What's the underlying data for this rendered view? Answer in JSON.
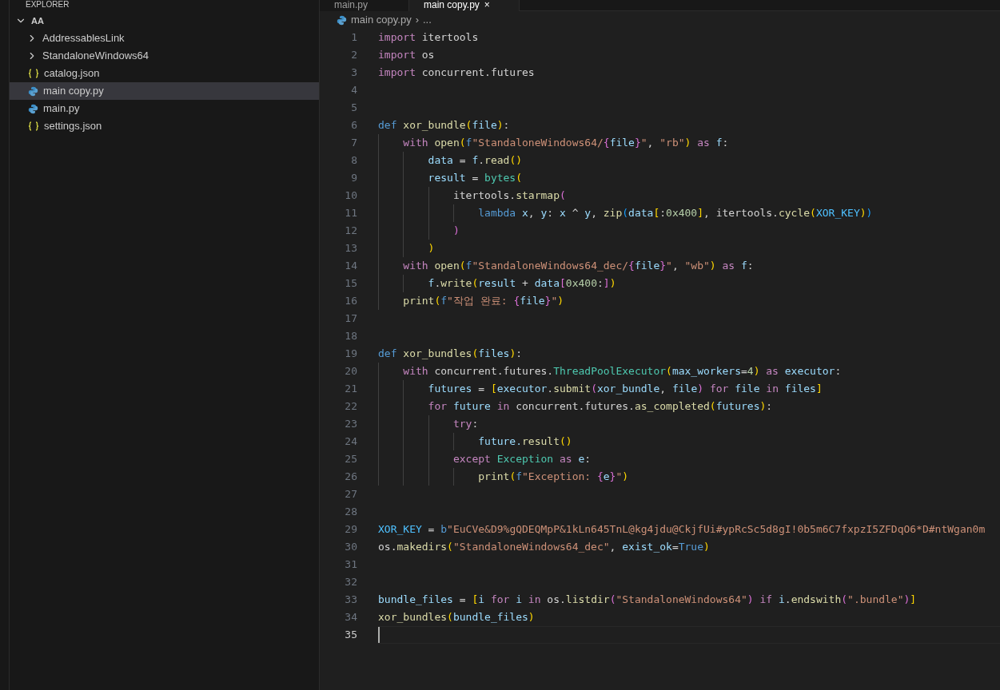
{
  "sidebar": {
    "title": "EXPLORER",
    "tree": [
      {
        "label": "AA",
        "kind": "folder",
        "expanded": true,
        "selected": false,
        "children": [
          {
            "label": "AddressablesLink",
            "kind": "folder",
            "expanded": false,
            "selected": false
          },
          {
            "label": "StandaloneWindows64",
            "kind": "folder",
            "expanded": false,
            "selected": false
          },
          {
            "label": "catalog.json",
            "kind": "json",
            "selected": false
          },
          {
            "label": "main copy.py",
            "kind": "python",
            "selected": true
          },
          {
            "label": "main.py",
            "kind": "python",
            "selected": false
          },
          {
            "label": "settings.json",
            "kind": "json",
            "selected": false
          }
        ]
      }
    ]
  },
  "tabs": [
    {
      "label": "main.py",
      "selected": false
    },
    {
      "label": "main copy.py",
      "selected": true,
      "close": "×"
    }
  ],
  "breadcrumb": {
    "file": "main copy.py",
    "separator": "›",
    "more": "..."
  },
  "code": [
    {
      "n": "1",
      "current": false,
      "tokens": [
        {
          "kind": "kw",
          "text": "import "
        },
        {
          "kind": "p",
          "text": "itertools"
        }
      ]
    },
    {
      "n": "2",
      "current": false,
      "tokens": [
        {
          "kind": "kw",
          "text": "import "
        },
        {
          "kind": "p",
          "text": "os"
        }
      ]
    },
    {
      "n": "3",
      "current": false,
      "tokens": [
        {
          "kind": "kw",
          "text": "import "
        },
        {
          "kind": "p",
          "text": "concurrent.futures"
        }
      ]
    },
    {
      "n": "4",
      "current": false
    },
    {
      "n": "5",
      "current": false
    },
    {
      "n": "6",
      "current": false,
      "tokens": [
        {
          "kind": "def",
          "text": "def "
        },
        {
          "kind": "fn",
          "text": "xor_bundle"
        },
        {
          "kind": "b1",
          "text": "("
        },
        {
          "kind": "var",
          "text": "file"
        },
        {
          "kind": "b1",
          "text": ")"
        },
        {
          "kind": "p",
          "text": ":"
        }
      ]
    },
    {
      "n": "7",
      "current": false,
      "tokens": [
        {
          "kind": "kw",
          "text": "    with "
        },
        {
          "kind": "fn",
          "text": "open"
        },
        {
          "kind": "b1",
          "text": "("
        },
        {
          "kind": "def",
          "text": "f"
        },
        {
          "kind": "str",
          "text": "\"StandaloneWindows64/"
        },
        {
          "kind": "esc",
          "text": "{"
        },
        {
          "kind": "var",
          "text": "file"
        },
        {
          "kind": "esc",
          "text": "}"
        },
        {
          "kind": "str",
          "text": "\""
        },
        {
          "kind": "p",
          "text": ", "
        },
        {
          "kind": "str",
          "text": "\"rb\""
        },
        {
          "kind": "b1",
          "text": ") "
        },
        {
          "kind": "kw",
          "text": "as "
        },
        {
          "kind": "var",
          "text": "f"
        },
        {
          "kind": "p",
          "text": ":"
        }
      ]
    },
    {
      "n": "8",
      "current": false,
      "tokens": [
        {
          "kind": "var",
          "text": "        data"
        },
        {
          "kind": "p",
          "text": " = "
        },
        {
          "kind": "var",
          "text": "f"
        },
        {
          "kind": "p",
          "text": "."
        },
        {
          "kind": "fn",
          "text": "read"
        },
        {
          "kind": "b1",
          "text": "()"
        }
      ]
    },
    {
      "n": "9",
      "current": false,
      "tokens": [
        {
          "kind": "var",
          "text": "        result"
        },
        {
          "kind": "p",
          "text": " = "
        },
        {
          "kind": "cls",
          "text": "bytes"
        },
        {
          "kind": "b1",
          "text": "("
        }
      ]
    },
    {
      "n": "10",
      "current": false,
      "tokens": [
        {
          "kind": "p",
          "text": "            itertools."
        },
        {
          "kind": "fn",
          "text": "starmap"
        },
        {
          "kind": "b2",
          "text": "("
        }
      ]
    },
    {
      "n": "11",
      "current": false,
      "tokens": [
        {
          "kind": "def",
          "text": "                lambda "
        },
        {
          "kind": "var",
          "text": "x"
        },
        {
          "kind": "p",
          "text": ", "
        },
        {
          "kind": "var",
          "text": "y"
        },
        {
          "kind": "p",
          "text": ": "
        },
        {
          "kind": "var",
          "text": "x"
        },
        {
          "kind": "p",
          "text": " ^ "
        },
        {
          "kind": "var",
          "text": "y"
        },
        {
          "kind": "p",
          "text": ", "
        },
        {
          "kind": "fn",
          "text": "zip"
        },
        {
          "kind": "b3",
          "text": "("
        },
        {
          "kind": "var",
          "text": "data"
        },
        {
          "kind": "b1",
          "text": "["
        },
        {
          "kind": "p",
          "text": ":"
        },
        {
          "kind": "num",
          "text": "0x400"
        },
        {
          "kind": "b1",
          "text": "]"
        },
        {
          "kind": "p",
          "text": ", itertools."
        },
        {
          "kind": "fn",
          "text": "cycle"
        },
        {
          "kind": "b1",
          "text": "("
        },
        {
          "kind": "const",
          "text": "XOR_KEY"
        },
        {
          "kind": "b1",
          "text": ")"
        },
        {
          "kind": "b3",
          "text": ")"
        }
      ]
    },
    {
      "n": "12",
      "current": false,
      "tokens": [
        {
          "kind": "b2",
          "text": "            )"
        }
      ]
    },
    {
      "n": "13",
      "current": false,
      "tokens": [
        {
          "kind": "b1",
          "text": "        )"
        }
      ]
    },
    {
      "n": "14",
      "current": false,
      "tokens": [
        {
          "kind": "kw",
          "text": "    with "
        },
        {
          "kind": "fn",
          "text": "open"
        },
        {
          "kind": "b1",
          "text": "("
        },
        {
          "kind": "def",
          "text": "f"
        },
        {
          "kind": "str",
          "text": "\"StandaloneWindows64_dec/"
        },
        {
          "kind": "esc",
          "text": "{"
        },
        {
          "kind": "var",
          "text": "file"
        },
        {
          "kind": "esc",
          "text": "}"
        },
        {
          "kind": "str",
          "text": "\""
        },
        {
          "kind": "p",
          "text": ", "
        },
        {
          "kind": "str",
          "text": "\"wb\""
        },
        {
          "kind": "b1",
          "text": ") "
        },
        {
          "kind": "kw",
          "text": "as "
        },
        {
          "kind": "var",
          "text": "f"
        },
        {
          "kind": "p",
          "text": ":"
        }
      ]
    },
    {
      "n": "15",
      "current": false,
      "tokens": [
        {
          "kind": "var",
          "text": "        f"
        },
        {
          "kind": "p",
          "text": "."
        },
        {
          "kind": "fn",
          "text": "write"
        },
        {
          "kind": "b1",
          "text": "("
        },
        {
          "kind": "var",
          "text": "result"
        },
        {
          "kind": "p",
          "text": " + "
        },
        {
          "kind": "var",
          "text": "data"
        },
        {
          "kind": "b2",
          "text": "["
        },
        {
          "kind": "num",
          "text": "0x400"
        },
        {
          "kind": "p",
          "text": ":"
        },
        {
          "kind": "b2",
          "text": "]"
        },
        {
          "kind": "b1",
          "text": ")"
        }
      ]
    },
    {
      "n": "16",
      "current": false,
      "tokens": [
        {
          "kind": "fn",
          "text": "    print"
        },
        {
          "kind": "b1",
          "text": "("
        },
        {
          "kind": "def",
          "text": "f"
        },
        {
          "kind": "str",
          "text": "\"작업 완료: "
        },
        {
          "kind": "esc",
          "text": "{"
        },
        {
          "kind": "var",
          "text": "file"
        },
        {
          "kind": "esc",
          "text": "}"
        },
        {
          "kind": "str",
          "text": "\""
        },
        {
          "kind": "b1",
          "text": ")"
        }
      ]
    },
    {
      "n": "17",
      "current": false
    },
    {
      "n": "18",
      "current": false
    },
    {
      "n": "19",
      "current": false,
      "tokens": [
        {
          "kind": "def",
          "text": "def "
        },
        {
          "kind": "fn",
          "text": "xor_bundles"
        },
        {
          "kind": "b1",
          "text": "("
        },
        {
          "kind": "var",
          "text": "files"
        },
        {
          "kind": "b1",
          "text": ")"
        },
        {
          "kind": "p",
          "text": ":"
        }
      ]
    },
    {
      "n": "20",
      "current": false,
      "tokens": [
        {
          "kind": "kw",
          "text": "    with "
        },
        {
          "kind": "p",
          "text": "concurrent.futures."
        },
        {
          "kind": "cls",
          "text": "ThreadPoolExecutor"
        },
        {
          "kind": "b1",
          "text": "("
        },
        {
          "kind": "var",
          "text": "max_workers"
        },
        {
          "kind": "p",
          "text": "="
        },
        {
          "kind": "num",
          "text": "4"
        },
        {
          "kind": "b1",
          "text": ") "
        },
        {
          "kind": "kw",
          "text": "as "
        },
        {
          "kind": "var",
          "text": "executor"
        },
        {
          "kind": "p",
          "text": ":"
        }
      ]
    },
    {
      "n": "21",
      "current": false,
      "tokens": [
        {
          "kind": "var",
          "text": "        futures"
        },
        {
          "kind": "p",
          "text": " = "
        },
        {
          "kind": "b1",
          "text": "["
        },
        {
          "kind": "var",
          "text": "executor"
        },
        {
          "kind": "p",
          "text": "."
        },
        {
          "kind": "fn",
          "text": "submit"
        },
        {
          "kind": "b2",
          "text": "("
        },
        {
          "kind": "var",
          "text": "xor_bundle"
        },
        {
          "kind": "p",
          "text": ", "
        },
        {
          "kind": "var",
          "text": "file"
        },
        {
          "kind": "b2",
          "text": ") "
        },
        {
          "kind": "kw",
          "text": "for "
        },
        {
          "kind": "var",
          "text": "file "
        },
        {
          "kind": "kw",
          "text": "in "
        },
        {
          "kind": "var",
          "text": "files"
        },
        {
          "kind": "b1",
          "text": "]"
        }
      ]
    },
    {
      "n": "22",
      "current": false,
      "tokens": [
        {
          "kind": "kw",
          "text": "        for "
        },
        {
          "kind": "var",
          "text": "future "
        },
        {
          "kind": "kw",
          "text": "in "
        },
        {
          "kind": "p",
          "text": "concurrent.futures."
        },
        {
          "kind": "fn",
          "text": "as_completed"
        },
        {
          "kind": "b1",
          "text": "("
        },
        {
          "kind": "var",
          "text": "futures"
        },
        {
          "kind": "b1",
          "text": ")"
        },
        {
          "kind": "p",
          "text": ":"
        }
      ]
    },
    {
      "n": "23",
      "current": false,
      "tokens": [
        {
          "kind": "kw",
          "text": "            try"
        },
        {
          "kind": "p",
          "text": ":"
        }
      ]
    },
    {
      "n": "24",
      "current": false,
      "tokens": [
        {
          "kind": "var",
          "text": "                future."
        },
        {
          "kind": "fn",
          "text": "result"
        },
        {
          "kind": "b1",
          "text": "()"
        }
      ]
    },
    {
      "n": "25",
      "current": false,
      "tokens": [
        {
          "kind": "kw",
          "text": "            except "
        },
        {
          "kind": "cls",
          "text": "Exception "
        },
        {
          "kind": "kw",
          "text": "as "
        },
        {
          "kind": "var",
          "text": "e"
        },
        {
          "kind": "p",
          "text": ":"
        }
      ]
    },
    {
      "n": "26",
      "current": false,
      "tokens": [
        {
          "kind": "fn",
          "text": "                print"
        },
        {
          "kind": "b1",
          "text": "("
        },
        {
          "kind": "def",
          "text": "f"
        },
        {
          "kind": "str",
          "text": "\"Exception: "
        },
        {
          "kind": "esc",
          "text": "{"
        },
        {
          "kind": "var",
          "text": "e"
        },
        {
          "kind": "esc",
          "text": "}"
        },
        {
          "kind": "str",
          "text": "\""
        },
        {
          "kind": "b1",
          "text": ")"
        }
      ]
    },
    {
      "n": "27",
      "current": false
    },
    {
      "n": "28",
      "current": false
    },
    {
      "n": "29",
      "current": false,
      "tokens": [
        {
          "kind": "const",
          "text": "XOR_KEY"
        },
        {
          "kind": "p",
          "text": " = "
        },
        {
          "kind": "def",
          "text": "b"
        },
        {
          "kind": "str",
          "text": "\"EuCVe&D9%gQDEQMpP&1kLn645TnL@kg4jdu@CkjfUi#ypRcSc5d8gI!0b5m6C7fxpzI5ZFDqO6*D#ntWgan0m"
        }
      ]
    },
    {
      "n": "30",
      "current": false,
      "tokens": [
        {
          "kind": "p",
          "text": "os."
        },
        {
          "kind": "fn",
          "text": "makedirs"
        },
        {
          "kind": "b1",
          "text": "("
        },
        {
          "kind": "str",
          "text": "\"StandaloneWindows64_dec\""
        },
        {
          "kind": "p",
          "text": ", "
        },
        {
          "kind": "var",
          "text": "exist_ok"
        },
        {
          "kind": "p",
          "text": "="
        },
        {
          "kind": "def",
          "text": "True"
        },
        {
          "kind": "b1",
          "text": ")"
        }
      ]
    },
    {
      "n": "31",
      "current": false
    },
    {
      "n": "32",
      "current": false
    },
    {
      "n": "33",
      "current": false,
      "tokens": [
        {
          "kind": "var",
          "text": "bundle_files"
        },
        {
          "kind": "p",
          "text": " = "
        },
        {
          "kind": "b1",
          "text": "["
        },
        {
          "kind": "var",
          "text": "i "
        },
        {
          "kind": "kw",
          "text": "for "
        },
        {
          "kind": "var",
          "text": "i "
        },
        {
          "kind": "kw",
          "text": "in "
        },
        {
          "kind": "p",
          "text": "os."
        },
        {
          "kind": "fn",
          "text": "listdir"
        },
        {
          "kind": "b2",
          "text": "("
        },
        {
          "kind": "str",
          "text": "\"StandaloneWindows64\""
        },
        {
          "kind": "b2",
          "text": ") "
        },
        {
          "kind": "kw",
          "text": "if "
        },
        {
          "kind": "var",
          "text": "i"
        },
        {
          "kind": "p",
          "text": "."
        },
        {
          "kind": "fn",
          "text": "endswith"
        },
        {
          "kind": "b2",
          "text": "("
        },
        {
          "kind": "str",
          "text": "\".bundle\""
        },
        {
          "kind": "b2",
          "text": ")"
        },
        {
          "kind": "b1",
          "text": "]"
        }
      ]
    },
    {
      "n": "34",
      "current": false,
      "tokens": [
        {
          "kind": "fn",
          "text": "xor_bundles"
        },
        {
          "kind": "b1",
          "text": "("
        },
        {
          "kind": "var",
          "text": "bundle_files"
        },
        {
          "kind": "b1",
          "text": ")"
        }
      ]
    },
    {
      "n": "35",
      "current": true
    }
  ]
}
